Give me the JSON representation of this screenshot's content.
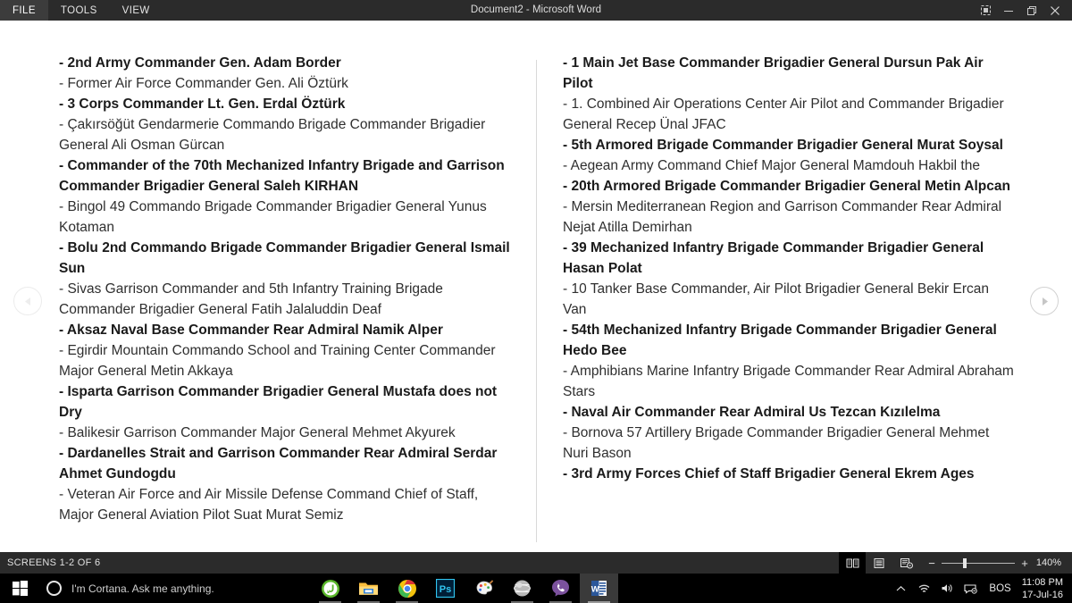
{
  "window": {
    "title": "Document2 - Microsoft Word",
    "menu_tabs": [
      {
        "label": "FILE",
        "active": true
      },
      {
        "label": "TOOLS",
        "active": false
      },
      {
        "label": "VIEW",
        "active": false
      }
    ],
    "controls": [
      {
        "name": "ribbon-display-options",
        "label": "Ribbon Display Options"
      },
      {
        "name": "minimize",
        "label": "Minimize"
      },
      {
        "name": "restore",
        "label": "Restore Down"
      },
      {
        "name": "close",
        "label": "Close"
      }
    ]
  },
  "document": {
    "left_column": [
      {
        "text": "- 2nd Army Commander Gen. Adam Border",
        "bold": true
      },
      {
        "text": "- Former Air Force Commander Gen. Ali Öztürk",
        "bold": false
      },
      {
        "text": "- 3 Corps Commander Lt. Gen. Erdal Öztürk",
        "bold": true
      },
      {
        "text": "- Çakırsöğüt Gendarmerie Commando Brigade Commander Brigadier General Ali Osman Gürcan",
        "bold": false
      },
      {
        "text": "- Commander of the 70th Mechanized Infantry Brigade and Garrison Commander Brigadier General Saleh KIRHAN",
        "bold": true
      },
      {
        "text": "- Bingol 49 Commando Brigade Commander Brigadier General Yunus Kotaman",
        "bold": false
      },
      {
        "text": "- Bolu 2nd Commando Brigade Commander Brigadier General Ismail Sun",
        "bold": true
      },
      {
        "text": "- Sivas Garrison Commander and 5th Infantry Training Brigade Commander Brigadier General Fatih Jalaluddin Deaf",
        "bold": false
      },
      {
        "text": "- Aksaz Naval Base Commander Rear Admiral Namik Alper",
        "bold": true
      },
      {
        "text": "- Egirdir Mountain Commando School and Training Center Commander Major General Metin Akkaya",
        "bold": false
      },
      {
        "text": "- Isparta Garrison Commander Brigadier General Mustafa does not Dry",
        "bold": true
      },
      {
        "text": "- Balikesir Garrison Commander Major General Mehmet Akyurek",
        "bold": false
      },
      {
        "text": "- Dardanelles Strait and Garrison Commander Rear Admiral Serdar Ahmet Gundogdu",
        "bold": true
      },
      {
        "text": "- Veteran Air Force and Air Missile Defense Command Chief of Staff, Major General Aviation Pilot Suat Murat Semiz",
        "bold": false
      }
    ],
    "right_column": [
      {
        "text": "- 1 Main Jet Base Commander Brigadier General Dursun Pak Air Pilot",
        "bold": true
      },
      {
        "text": "- 1. Combined Air Operations Center Air Pilot and Commander Brigadier General Recep Ünal JFAC",
        "bold": false
      },
      {
        "text": "- 5th Armored Brigade Commander Brigadier General Murat Soysal",
        "bold": true
      },
      {
        "text": "- Aegean Army Command Chief Major General Mamdouh Hakbil the",
        "bold": false
      },
      {
        "text": "- 20th Armored Brigade Commander Brigadier General Metin Alpcan",
        "bold": true
      },
      {
        "text": "- Mersin Mediterranean Region and Garrison Commander Rear Admiral Nejat Atilla Demirhan",
        "bold": false
      },
      {
        "text": "- 39 Mechanized Infantry Brigade Commander Brigadier General Hasan Polat",
        "bold": true
      },
      {
        "text": "- 10 Tanker Base Commander, Air Pilot Brigadier General Bekir Ercan Van",
        "bold": false
      },
      {
        "text": "- 54th Mechanized Infantry Brigade Commander Brigadier General Hedo Bee",
        "bold": true
      },
      {
        "text": "- Amphibians Marine Infantry Brigade Commander Rear Admiral Abraham Stars",
        "bold": false
      },
      {
        "text": "- Naval Air Commander Rear Admiral Us Tezcan Kızılelma",
        "bold": true
      },
      {
        "text": "- Bornova 57 Artillery Brigade Commander Brigadier General Mehmet Nuri Bason",
        "bold": false
      },
      {
        "text": "- 3rd Army Forces Chief of Staff Brigadier General Ekrem Ages",
        "bold": true
      }
    ],
    "nav": {
      "prev_label": "Previous Screen",
      "next_label": "Next Screen"
    }
  },
  "statusbar": {
    "screens_label": "SCREENS 1-2 OF 6",
    "view_buttons": [
      {
        "name": "read-mode-icon",
        "label": "Read Mode",
        "active": true
      },
      {
        "name": "print-layout-icon",
        "label": "Print Layout",
        "active": false
      },
      {
        "name": "web-layout-icon",
        "label": "Web Layout",
        "active": false
      }
    ],
    "zoom": {
      "minus": "−",
      "plus": "+",
      "percent": "140%"
    }
  },
  "taskbar": {
    "start_label": "Start",
    "cortana_placeholder": "I'm Cortana. Ask me anything.",
    "apps": [
      {
        "name": "utorrent",
        "running": true,
        "active": false
      },
      {
        "name": "file-explorer",
        "running": true,
        "active": false
      },
      {
        "name": "google-chrome",
        "running": true,
        "active": false
      },
      {
        "name": "photoshop",
        "running": false,
        "active": false
      },
      {
        "name": "paint",
        "running": false,
        "active": false
      },
      {
        "name": "sphere-app",
        "running": true,
        "active": false
      },
      {
        "name": "viber",
        "running": true,
        "active": false
      },
      {
        "name": "microsoft-word",
        "running": true,
        "active": true
      }
    ],
    "tray": {
      "language": "BOS",
      "time": "11:08 PM",
      "date": "17-Jul-16"
    }
  },
  "colors": {
    "titlebar": "#2b2b2b",
    "statusbar": "#2b2b2b",
    "taskbar": "#000000",
    "page": "#ffffff",
    "text": "#2f2f2f"
  }
}
